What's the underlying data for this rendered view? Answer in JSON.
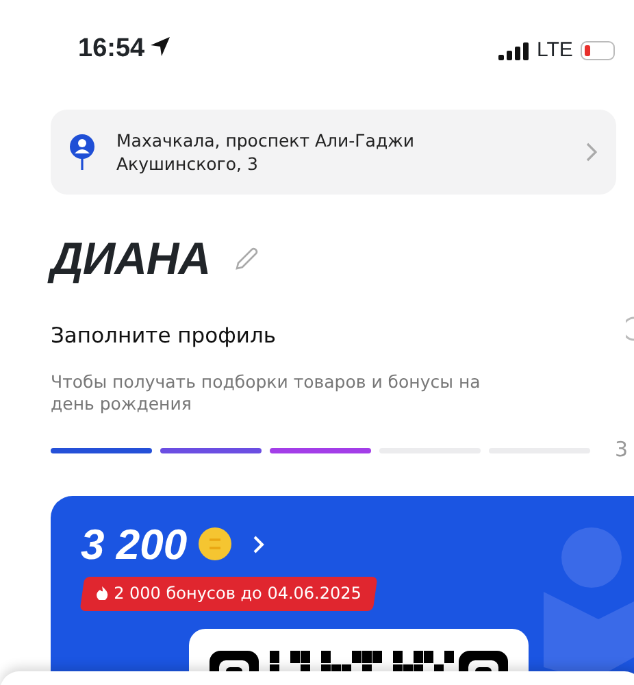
{
  "status_bar": {
    "time": "16:54",
    "network": "LTE"
  },
  "address": {
    "text": "Махачкала, проспект Али-Гаджи Акушинского, 3"
  },
  "profile": {
    "name": "ДИАНА"
  },
  "fill_profile": {
    "title": "Заполните профиль",
    "subtitle": "Чтобы получать подборки товаров и бонусы на день рождения",
    "steps": [
      {
        "filled": true,
        "color": "#2550d8"
      },
      {
        "filled": true,
        "color": "#6b4ee2"
      },
      {
        "filled": true,
        "color": "#a33ee8"
      },
      {
        "filled": false
      },
      {
        "filled": false
      }
    ],
    "counter": "3"
  },
  "bonus_card": {
    "balance": "3 200",
    "expiring": "2 000 бонусов до 04.06.2025"
  }
}
